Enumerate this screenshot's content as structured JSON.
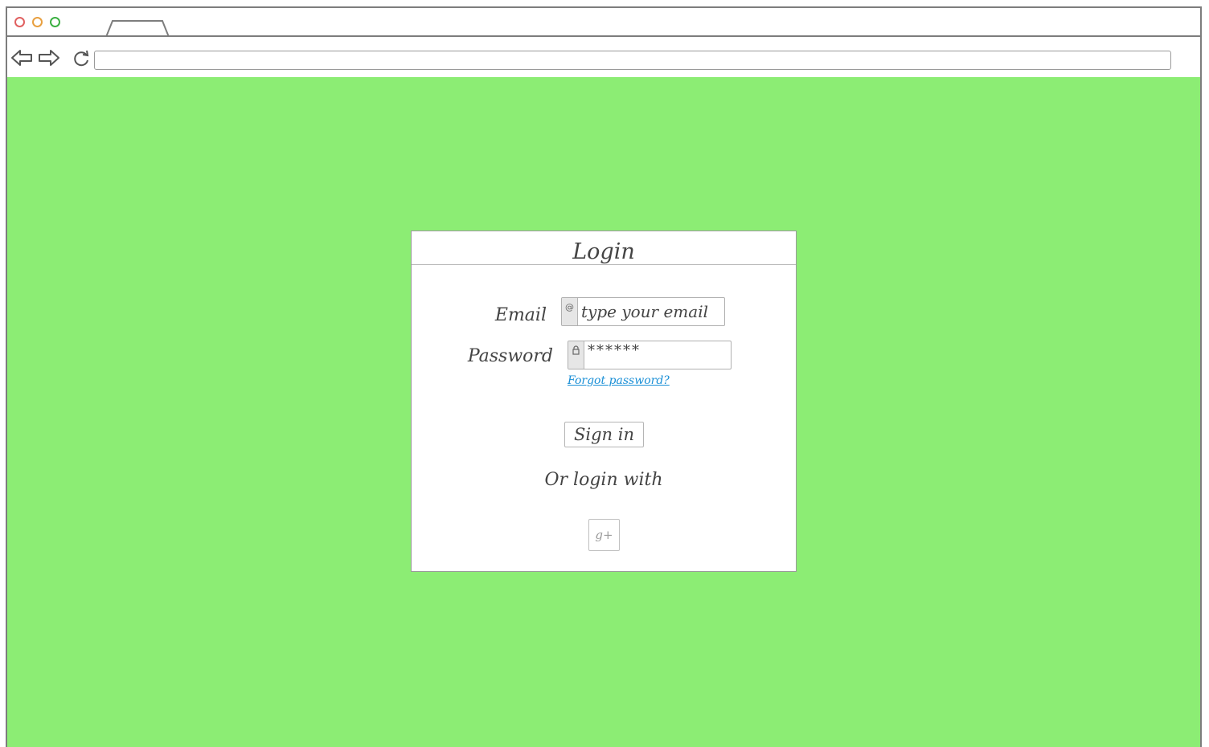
{
  "browser": {
    "window_controls": [
      "close",
      "minimize",
      "maximize"
    ],
    "icons": [
      "back-arrow-icon",
      "forward-arrow-icon",
      "reload-icon"
    ],
    "address_bar_value": ""
  },
  "colors": {
    "page_background": "#8ced74",
    "link": "#1a8fd6",
    "close_dot": "#e06060",
    "minimize_dot": "#e8a040",
    "maximize_dot": "#3cb043"
  },
  "login": {
    "title": "Login",
    "email_label": "Email",
    "email_placeholder": "type your email",
    "email_icon": "at-sign-icon",
    "password_label": "Password",
    "password_value": "******",
    "password_icon": "lock-icon",
    "forgot_password": "Forgot password?",
    "sign_in_label": "Sign in",
    "alt_login_text": "Or login with",
    "google_plus_label": "g+"
  }
}
